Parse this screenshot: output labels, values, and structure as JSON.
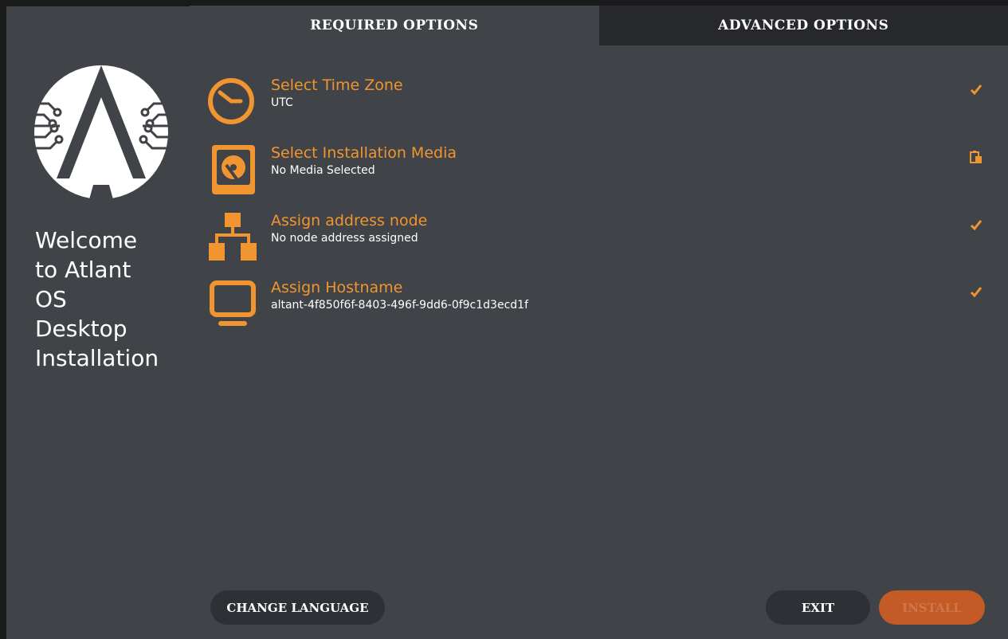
{
  "tabs": [
    {
      "label": "REQUIRED OPTIONS",
      "active": true
    },
    {
      "label": "ADVANCED OPTIONS",
      "active": false
    }
  ],
  "sidebar": {
    "logo_icon": "atlant-logo",
    "welcome_lines": [
      "Welcome",
      "to Atlant",
      "OS",
      "Desktop",
      "Installation"
    ]
  },
  "options": [
    {
      "icon": "clock-icon",
      "title": "Select Time Zone",
      "subtitle": "UTC",
      "status_icon": "check-icon"
    },
    {
      "icon": "disk-icon",
      "title": "Select Installation Media",
      "subtitle": "No Media Selected",
      "status_icon": "clipboard-icon"
    },
    {
      "icon": "network-icon",
      "title": "Assign address node",
      "subtitle": "No node address assigned",
      "status_icon": "check-icon"
    },
    {
      "icon": "monitor-icon",
      "title": "Assign Hostname",
      "subtitle": "altant-4f850f6f-8403-496f-9dd6-0f9c1d3ecd1f",
      "status_icon": "check-icon"
    }
  ],
  "footer": {
    "change_language_label": "CHANGE LANGUAGE",
    "exit_label": "EXIT",
    "install_label": "INSTALL"
  },
  "colors": {
    "accent": "#f0952f",
    "background": "#404347",
    "tab_inactive": "#26282b",
    "install_button": "#c45a26"
  }
}
